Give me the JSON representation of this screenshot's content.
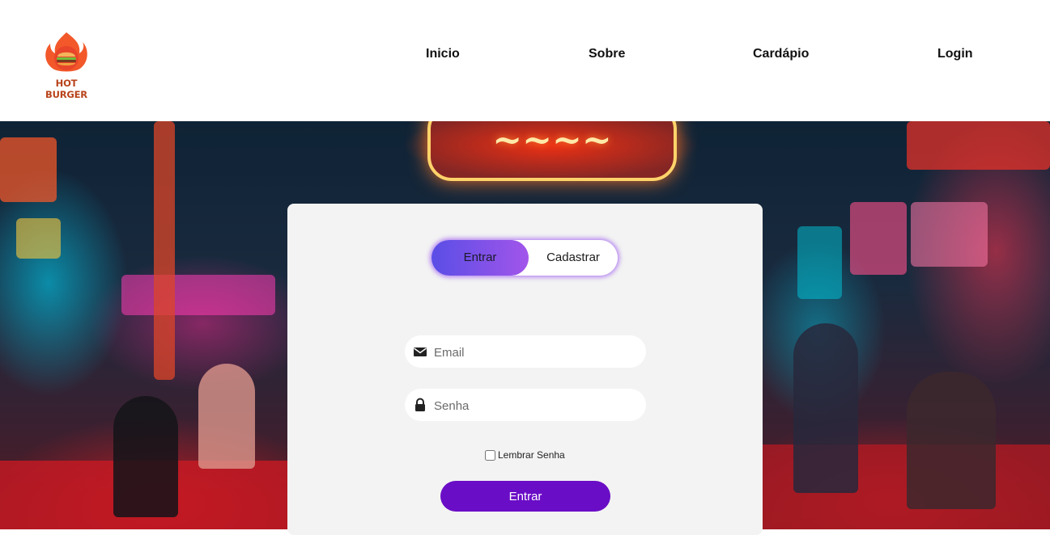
{
  "brand": {
    "logo_text": "HOT BURGER"
  },
  "nav": {
    "items": [
      {
        "label": "Inicio"
      },
      {
        "label": "Sobre"
      },
      {
        "label": "Cardápio"
      },
      {
        "label": "Login"
      }
    ]
  },
  "login": {
    "tabs": [
      {
        "label": "Entrar",
        "active": true
      },
      {
        "label": "Cadastrar",
        "active": false
      }
    ],
    "email": {
      "placeholder": "Email",
      "value": "",
      "icon": "envelope-icon"
    },
    "password": {
      "placeholder": "Senha",
      "value": "",
      "icon": "lock-icon"
    },
    "remember_label": "Lembrar Senha",
    "remember_checked": false,
    "submit_label": "Entrar"
  },
  "colors": {
    "accent": "#6a0dc6",
    "toggle_gradient_start": "#5a4ee6",
    "toggle_gradient_end": "#a255ea",
    "card_bg": "#f3f3f3"
  }
}
